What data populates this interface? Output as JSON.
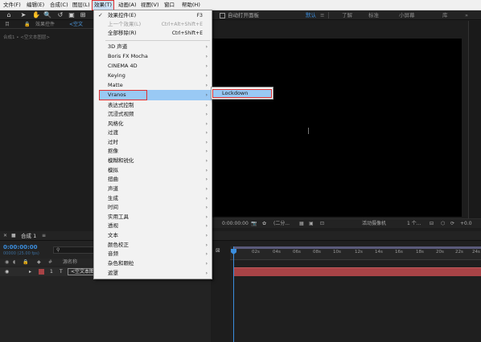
{
  "menubar": {
    "items": [
      "文件(F)",
      "编辑(E)",
      "合成(C)",
      "图层(L)",
      "效果(T)",
      "动画(A)",
      "视图(V)",
      "窗口",
      "帮助(H)"
    ]
  },
  "toolbar": {
    "auto_open": "自动打开面板",
    "workspaces": [
      "默认",
      "了解",
      "标准",
      "小屏幕",
      "库"
    ]
  },
  "left_panel": {
    "tab_project": "目",
    "tab_effects": "效果控件",
    "tab_effects_layer": "<空文",
    "breadcrumb": "合成1 • <空文本图层>"
  },
  "effects_menu": {
    "items": [
      {
        "label": "效果控件(E)",
        "shortcut": "F3",
        "checked": true
      },
      {
        "label": "上一个效果(L)",
        "shortcut": "Ctrl+Alt+Shift+E",
        "disabled": true
      },
      {
        "label": "全部移除(R)",
        "shortcut": "Ctrl+Shift+E"
      },
      {
        "label": "3D 声道",
        "submenu": true
      },
      {
        "label": "Boris FX Mocha",
        "submenu": true
      },
      {
        "label": "CINEMA 4D",
        "submenu": true
      },
      {
        "label": "Keying",
        "submenu": true
      },
      {
        "label": "Matte",
        "submenu": true
      },
      {
        "label": "Vranos",
        "submenu": true,
        "highlighted": true
      },
      {
        "label": "表达式控制",
        "submenu": true
      },
      {
        "label": "沉浸式视频",
        "submenu": true
      },
      {
        "label": "风格化",
        "submenu": true
      },
      {
        "label": "过渡",
        "submenu": true
      },
      {
        "label": "过时",
        "submenu": true
      },
      {
        "label": "抠像",
        "submenu": true
      },
      {
        "label": "模糊和锐化",
        "submenu": true
      },
      {
        "label": "模拟",
        "submenu": true
      },
      {
        "label": "扭曲",
        "submenu": true
      },
      {
        "label": "声道",
        "submenu": true
      },
      {
        "label": "生成",
        "submenu": true
      },
      {
        "label": "时间",
        "submenu": true
      },
      {
        "label": "实用工具",
        "submenu": true
      },
      {
        "label": "透视",
        "submenu": true
      },
      {
        "label": "文本",
        "submenu": true
      },
      {
        "label": "颜色校正",
        "submenu": true
      },
      {
        "label": "音频",
        "submenu": true
      },
      {
        "label": "杂色和颗粒",
        "submenu": true
      },
      {
        "label": "遮罩",
        "submenu": true
      }
    ],
    "vranos_submenu": [
      "Lockdown"
    ]
  },
  "viewer": {
    "timecode": "0:00:00:00",
    "resolution": "(二分...",
    "camera": "活动摄像机",
    "views": "1 个...",
    "exposure": "+0.0"
  },
  "timeline": {
    "comp_tab": "合成 1",
    "timecode": "0:00:00:00",
    "fps": "00000 (25.00 fps)",
    "col_number": "#",
    "col_name": "源名称",
    "layer": {
      "number": "1",
      "type": "T",
      "name": "<空文本图层>"
    },
    "ruler_labels": [
      "0s",
      "02s",
      "04s",
      "06s",
      "08s",
      "10s",
      "12s",
      "14s",
      "16s",
      "18s",
      "20s",
      "22s",
      "24s"
    ]
  },
  "colors": {
    "accent": "#3b8ede",
    "highlight": "#99c9f4",
    "annotation": "#e03030",
    "layer_bar": "#a84346"
  }
}
